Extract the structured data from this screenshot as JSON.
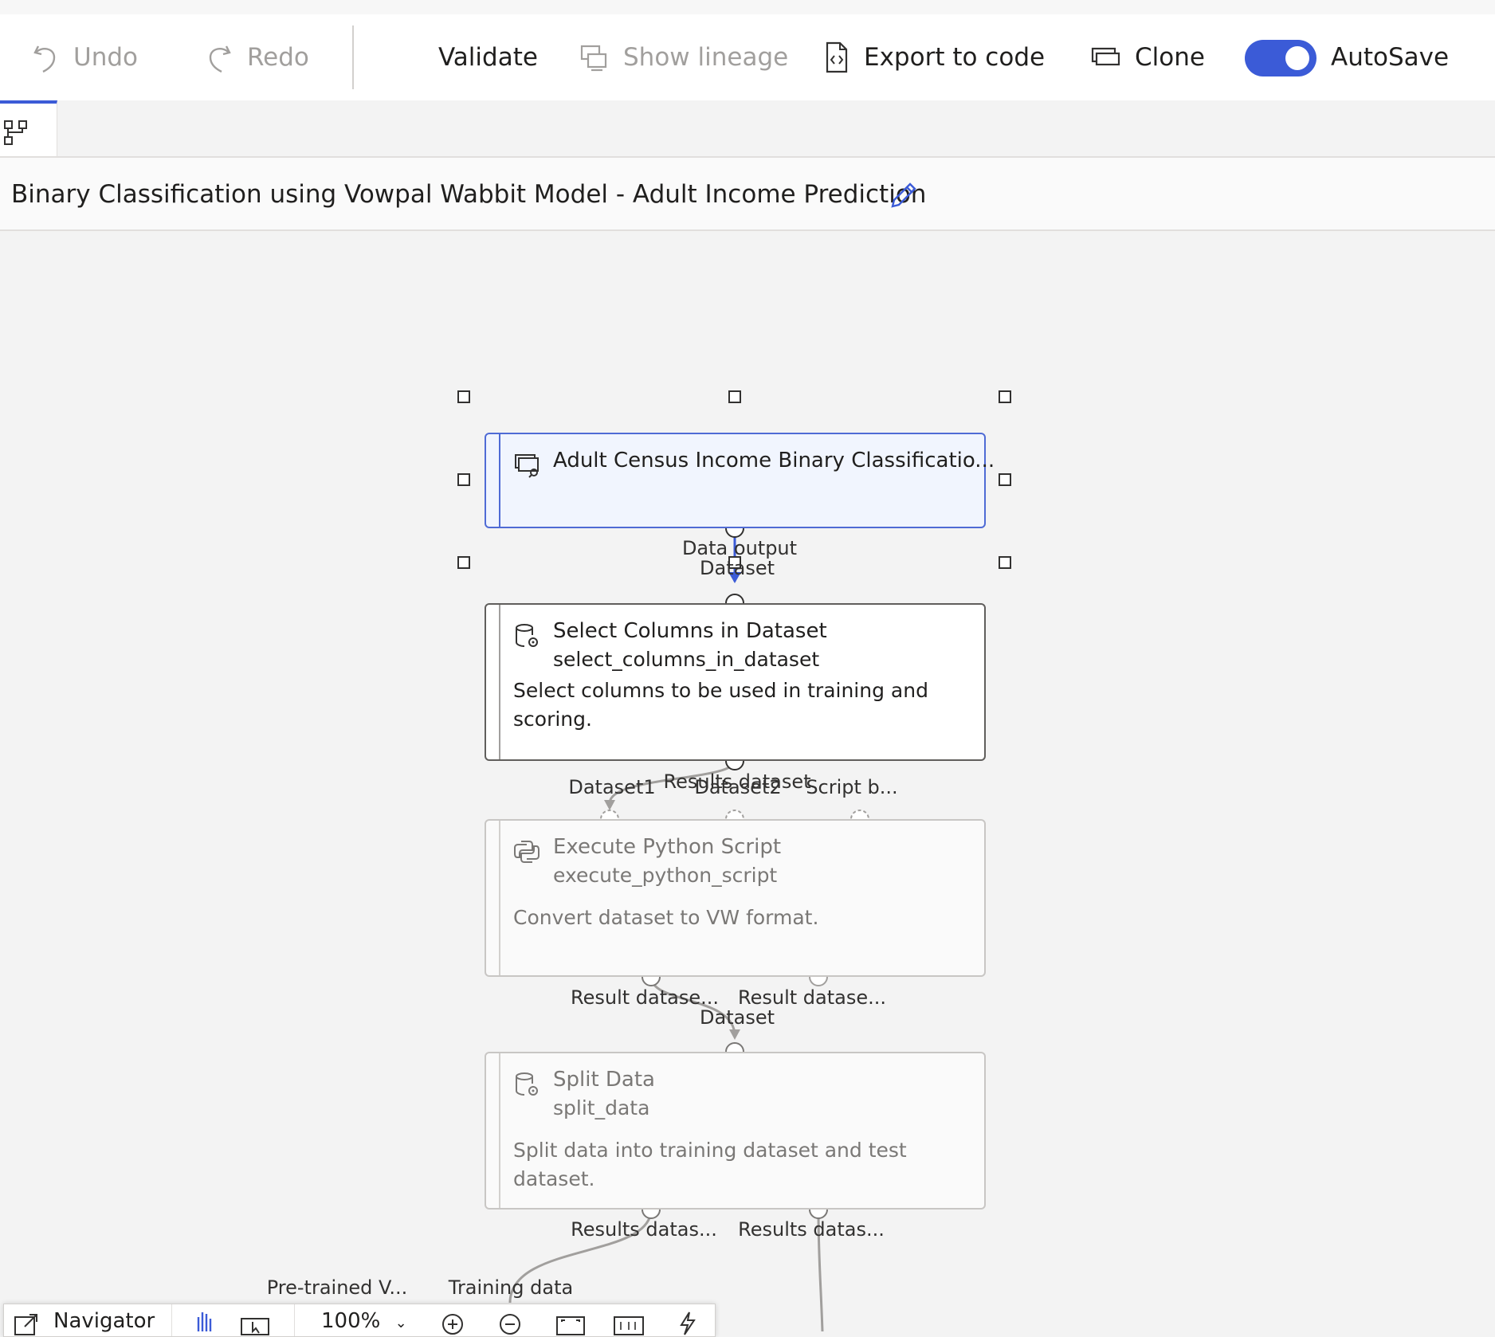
{
  "toolbar": {
    "undo": "Undo",
    "redo": "Redo",
    "validate": "Validate",
    "show_lineage": "Show lineage",
    "export_to_code": "Export to code",
    "clone": "Clone",
    "autosave": "AutoSave",
    "autosave_on": true
  },
  "pipeline": {
    "title": "Binary Classification using Vowpal Wabbit Model - Adult Income Prediction"
  },
  "nodes": [
    {
      "title": "Adult Census Income Binary Classificatio...",
      "subtitle": "",
      "description": "",
      "icon": "dataset-icon",
      "state": "selected"
    },
    {
      "title": "Select Columns in Dataset",
      "subtitle": "select_columns_in_dataset",
      "description": "Select columns to be used in training and scoring.",
      "icon": "module-icon",
      "state": "normal"
    },
    {
      "title": "Execute Python Script",
      "subtitle": "execute_python_script",
      "description": "Convert dataset to VW format.",
      "icon": "python-icon",
      "state": "faded"
    },
    {
      "title": "Split Data",
      "subtitle": "split_data",
      "description": "Split data into training dataset and test dataset.",
      "icon": "module-icon",
      "state": "faded"
    }
  ],
  "ports": {
    "n1_out": "Data output",
    "n2_in": "Dataset",
    "n2_out": "Results dataset",
    "n3_in1": "Dataset1",
    "n3_in2": "Dataset2",
    "n3_in3": "Script b...",
    "n3_out1": "Result datase...",
    "n3_out2": "Result datase...",
    "n4_in": "Dataset",
    "n4_out1": "Results datas...",
    "n4_out2": "Results datas...",
    "n5_in1": "Pre-trained V...",
    "n5_in2": "Training data"
  },
  "navigator": {
    "label": "Navigator",
    "zoom": "100%"
  }
}
